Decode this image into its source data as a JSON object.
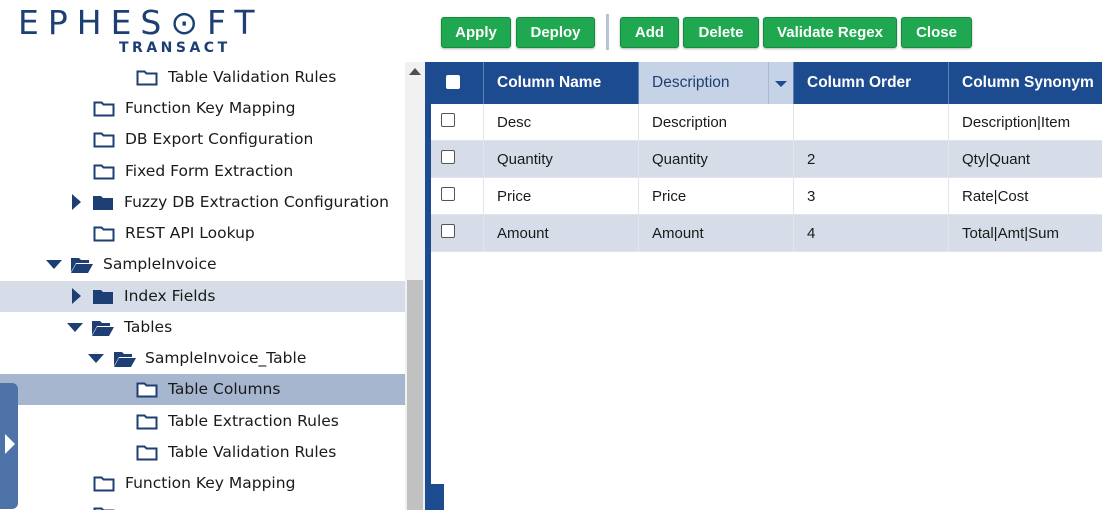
{
  "logo": {
    "main": "EPHES⊙FT",
    "sub": "TRANSACT"
  },
  "tree": {
    "items": [
      {
        "label": "Table Validation Rules",
        "icon": "folder-outline-icon",
        "arrow": ""
      },
      {
        "label": "Function Key Mapping",
        "icon": "folder-outline-icon",
        "arrow": ""
      },
      {
        "label": "DB Export Configuration",
        "icon": "folder-outline-icon",
        "arrow": ""
      },
      {
        "label": "Fixed Form Extraction",
        "icon": "folder-outline-icon",
        "arrow": ""
      },
      {
        "label": "Fuzzy DB Extraction Configuration",
        "icon": "folder-filled-icon",
        "arrow": "collapsed"
      },
      {
        "label": "REST API Lookup",
        "icon": "folder-outline-icon",
        "arrow": ""
      },
      {
        "label": "SampleInvoice",
        "icon": "folder-open-icon",
        "arrow": "expanded"
      },
      {
        "label": "Index Fields",
        "icon": "folder-filled-icon",
        "arrow": "collapsed"
      },
      {
        "label": "Tables",
        "icon": "folder-open-icon",
        "arrow": "expanded"
      },
      {
        "label": "SampleInvoice_Table",
        "icon": "folder-open-icon",
        "arrow": "expanded"
      },
      {
        "label": "Table Columns",
        "icon": "folder-outline-icon",
        "arrow": ""
      },
      {
        "label": "Table Extraction Rules",
        "icon": "folder-outline-icon",
        "arrow": ""
      },
      {
        "label": "Table Validation Rules",
        "icon": "folder-outline-icon",
        "arrow": ""
      },
      {
        "label": "Function Key Mapping",
        "icon": "folder-outline-icon",
        "arrow": ""
      }
    ]
  },
  "toolbar": {
    "apply": "Apply",
    "deploy": "Deploy",
    "add": "Add",
    "delete": "Delete",
    "validate_regex": "Validate Regex",
    "close": "Close"
  },
  "grid": {
    "headers": [
      "Column Name",
      "Description",
      "Column Order",
      "Column Synonym"
    ],
    "rows": [
      [
        "Desc",
        "Description",
        "",
        "Description|Item"
      ],
      [
        "Quantity",
        "Quantity",
        "2",
        "Qty|Quant"
      ],
      [
        "Price",
        "Price",
        "3",
        "Rate|Cost"
      ],
      [
        "Amount",
        "Amount",
        "4",
        "Total|Amt|Sum"
      ]
    ]
  },
  "colors": {
    "brand": "#1d3f73",
    "header_bg": "#1d4b8f",
    "button_green": "#1fa84f",
    "row_alt": "#d6dde8",
    "selected": "#a6b6cf"
  }
}
